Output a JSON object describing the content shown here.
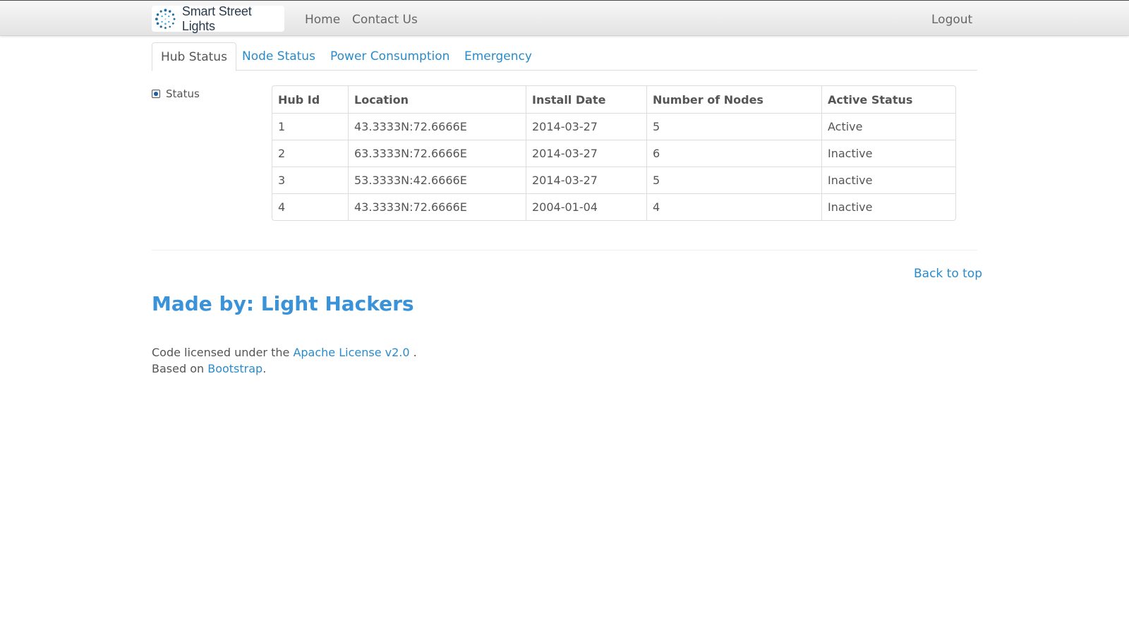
{
  "brand": {
    "name": "Smart Street Lights",
    "icon": "dotted-circle-logo-icon"
  },
  "nav": {
    "home": "Home",
    "contact": "Contact Us",
    "logout": "Logout"
  },
  "tabs": [
    {
      "label": "Hub Status",
      "active": true
    },
    {
      "label": "Node Status",
      "active": false
    },
    {
      "label": "Power Consumption",
      "active": false
    },
    {
      "label": "Emergency",
      "active": false
    }
  ],
  "sidebar": {
    "status_label": "Status"
  },
  "table": {
    "headers": [
      "Hub Id",
      "Location",
      "Install Date",
      "Number of Nodes",
      "Active Status"
    ],
    "rows": [
      [
        "1",
        "43.3333N:72.6666E",
        "2014-03-27",
        "5",
        "Active"
      ],
      [
        "2",
        "63.3333N:72.6666E",
        "2014-03-27",
        "6",
        "Inactive"
      ],
      [
        "3",
        "53.3333N:42.6666E",
        "2014-03-27",
        "5",
        "Inactive"
      ],
      [
        "4",
        "43.3333N:72.6666E",
        "2004-01-04",
        "4",
        "Inactive"
      ]
    ]
  },
  "footer": {
    "back_to_top": "Back to top",
    "made_by": "Made by: Light Hackers",
    "license_prefix": "Code licensed under the ",
    "license_link": "Apache License v2.0",
    "license_suffix": " .",
    "based_prefix": "Based on ",
    "based_link": "Bootstrap",
    "based_suffix": "."
  },
  "colors": {
    "link": "#2a8bcb",
    "heading": "#3a92d8",
    "text": "#555555"
  }
}
